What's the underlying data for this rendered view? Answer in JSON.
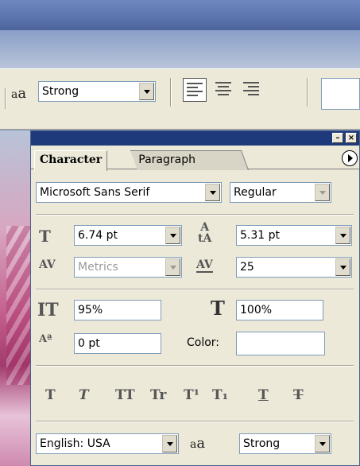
{
  "options_bar": {
    "antialias": {
      "icon_small": "a",
      "icon_big": "a",
      "value": "Strong"
    },
    "align": [
      "align-left",
      "align-center",
      "align-right"
    ]
  },
  "panel": {
    "tabs": [
      "Character",
      "Paragraph"
    ],
    "font_family": "Microsoft Sans Serif",
    "font_style": "Regular",
    "font_size": "6.74 pt",
    "leading": "5.31 pt",
    "kerning": "Metrics",
    "tracking": "25",
    "vertical_scale": "95%",
    "horizontal_scale": "100%",
    "baseline_shift": "0 pt",
    "color_label": "Color:",
    "style_buttons": [
      "T",
      "T",
      "TT",
      "Tr",
      "T¹",
      "T₁",
      "T",
      "T"
    ],
    "language": "English: USA",
    "antialias_value": "Strong",
    "antialias_icon": "a"
  }
}
